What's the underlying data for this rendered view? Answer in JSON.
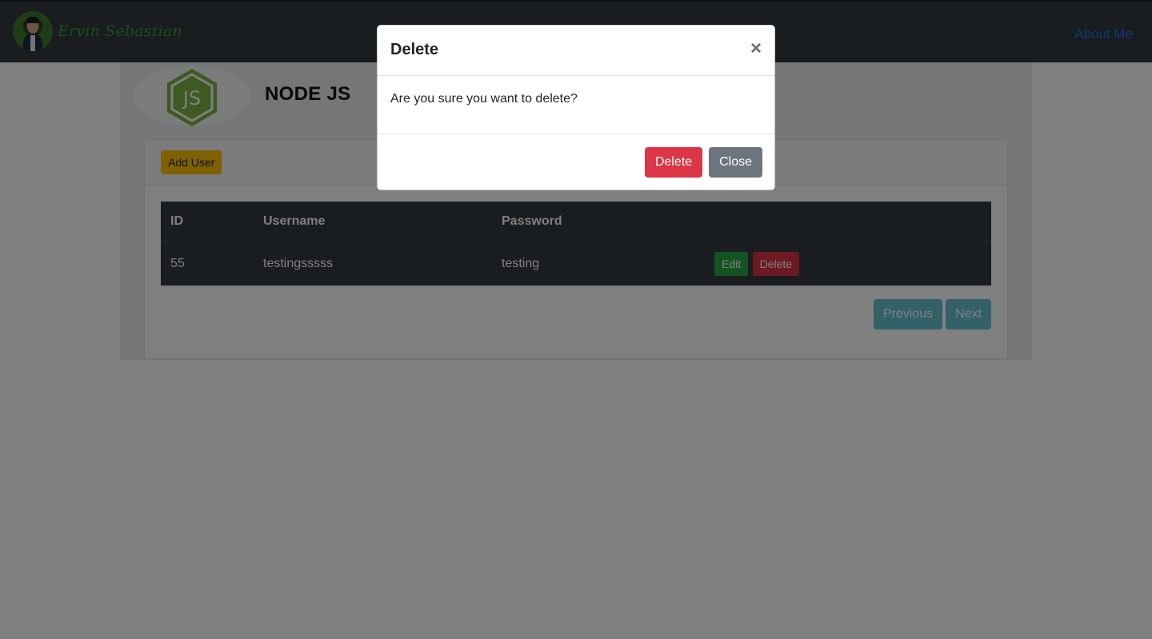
{
  "navbar": {
    "brand_name": "Ervin Sebastian",
    "about_link": "About Me"
  },
  "header": {
    "title": "NODE JS",
    "logo_text": "JS"
  },
  "card": {
    "add_user_label": "Add User"
  },
  "table": {
    "columns": [
      "ID",
      "Username",
      "Password",
      ""
    ],
    "rows": [
      {
        "id": "55",
        "username": "testingsssss",
        "password": "testing",
        "edit_label": "Edit",
        "delete_label": "Delete"
      }
    ]
  },
  "pagination": {
    "previous_label": "Previous",
    "next_label": "Next"
  },
  "modal": {
    "title": "Delete",
    "close_icon": "×",
    "message": "Are you sure you want to delete?",
    "delete_label": "Delete",
    "close_label": "Close"
  },
  "colors": {
    "navbar_bg": "#343a40",
    "brand_text": "#2e9e3a",
    "link": "#1f6fe0",
    "warning": "#ffc107",
    "success": "#28a745",
    "danger": "#dc3545",
    "info": "#17a2b8",
    "secondary": "#6c757d",
    "node_green": "#7cb342"
  }
}
